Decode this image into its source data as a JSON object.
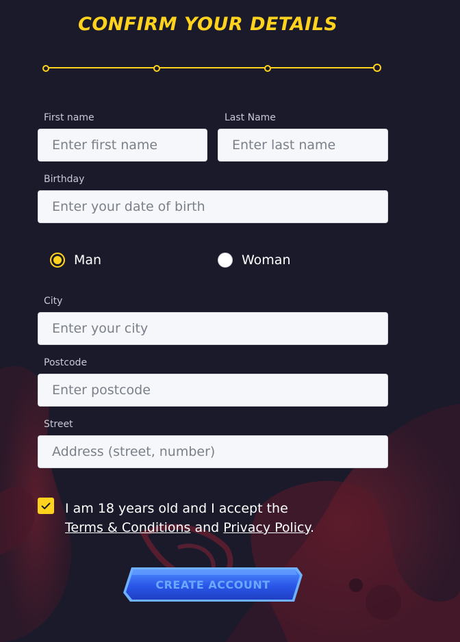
{
  "colors": {
    "accent": "#ffd21e",
    "background": "#1b1a2b",
    "cta": "#2a56e8"
  },
  "header": {
    "title": "CONFIRM YOUR DETAILS"
  },
  "progress": {
    "steps": 4,
    "current": 4
  },
  "form": {
    "first_name": {
      "label": "First name",
      "placeholder": "Enter first name",
      "value": ""
    },
    "last_name": {
      "label": "Last Name",
      "placeholder": "Enter last name",
      "value": ""
    },
    "birthday": {
      "label": "Birthday",
      "placeholder": "Enter your date of birth",
      "value": ""
    },
    "gender": {
      "options": [
        "Man",
        "Woman"
      ],
      "selected": "Man"
    },
    "city": {
      "label": "City",
      "placeholder": "Enter your city",
      "value": ""
    },
    "postcode": {
      "label": "Postcode",
      "placeholder": "Enter postcode",
      "value": ""
    },
    "street": {
      "label": "Street",
      "placeholder": "Address (street, number)",
      "value": ""
    }
  },
  "consent": {
    "checked": true,
    "text": "I am 18 years old and I accept the",
    "terms_link": "Terms & Conditions",
    "and_text": "and",
    "privacy_link": "Privacy Policy",
    "period": "."
  },
  "cta": {
    "label": "CREATE ACCOUNT"
  }
}
